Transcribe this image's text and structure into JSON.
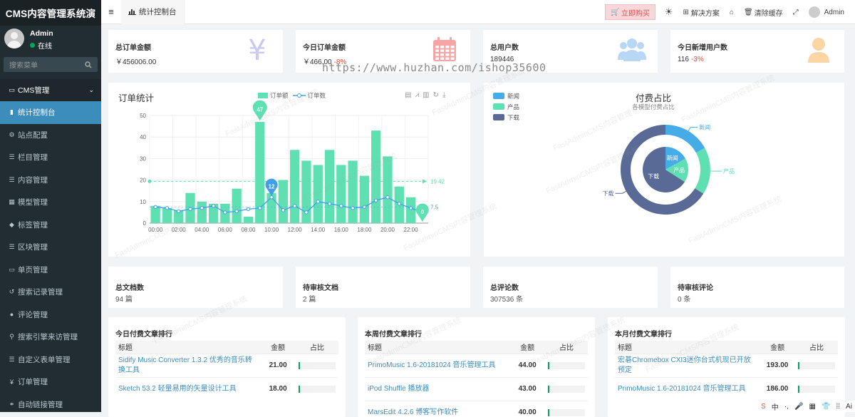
{
  "app_title": "CMS内容管理系统演",
  "user": {
    "name": "Admin",
    "status": "在线"
  },
  "search": {
    "placeholder": "搜索菜单"
  },
  "menu": {
    "header": "CMS管理",
    "items": [
      {
        "label": "统计控制台",
        "icon": "bar-chart-icon"
      },
      {
        "label": "站点配置",
        "icon": "cogs-icon"
      },
      {
        "label": "栏目管理",
        "icon": "list-icon"
      },
      {
        "label": "内容管理",
        "icon": "list-icon"
      },
      {
        "label": "模型管理",
        "icon": "grid-icon"
      },
      {
        "label": "标签管理",
        "icon": "tags-icon"
      },
      {
        "label": "区块管理",
        "icon": "list-icon"
      },
      {
        "label": "单页管理",
        "icon": "file-icon"
      },
      {
        "label": "搜索记录管理",
        "icon": "history-icon"
      },
      {
        "label": "评论管理",
        "icon": "comment-icon"
      },
      {
        "label": "搜索引擎来访管理",
        "icon": "search-icon"
      },
      {
        "label": "自定义表单管理",
        "icon": "list-icon"
      },
      {
        "label": "订单管理",
        "icon": "yen-icon"
      },
      {
        "label": "自动链接管理",
        "icon": "link-icon"
      }
    ]
  },
  "topbar": {
    "tab": "统计控制台",
    "buy": "立即购买",
    "solution": "解决方案",
    "clear_cache": "清除缓存",
    "user": "Admin"
  },
  "stats": [
    {
      "label": "总订单金额",
      "value": "￥456006.00",
      "delta": "",
      "icon": "yen-icon",
      "color": "#c9c9f2"
    },
    {
      "label": "今日订单金额",
      "value": "￥466.00",
      "delta": "-8%",
      "icon": "calendar-icon",
      "color": "#f5a5a5"
    },
    {
      "label": "总用户数",
      "value": "189446",
      "delta": "",
      "icon": "users-icon",
      "color": "#b8d7f5"
    },
    {
      "label": "今日新增用户数",
      "value": "116",
      "delta": "-3%",
      "icon": "user-icon",
      "color": "#fbd6a4"
    }
  ],
  "stats2": [
    {
      "label": "总文档数",
      "value": "94 篇"
    },
    {
      "label": "待审核文档",
      "value": "2 篇"
    },
    {
      "label": "总评论数",
      "value": "307536 条"
    },
    {
      "label": "待审核评论",
      "value": "0 条"
    }
  ],
  "chart_data": [
    {
      "type": "bar",
      "title": "订单统计",
      "legend": [
        "订单额",
        "订单数"
      ],
      "categories": [
        "00:00",
        "01:00",
        "02:00",
        "03:00",
        "04:00",
        "05:00",
        "06:00",
        "07:00",
        "08:00",
        "09:00",
        "10:00",
        "11:00",
        "12:00",
        "13:00",
        "14:00",
        "15:00",
        "16:00",
        "17:00",
        "18:00",
        "19:00",
        "20:00",
        "21:00",
        "22:00",
        "23:00"
      ],
      "ytick_labels": [
        "0",
        "10",
        "20",
        "30",
        "40",
        "50"
      ],
      "xtick_labels": [
        "00:00",
        "02:00",
        "04:00",
        "06:00",
        "08:00",
        "10:00",
        "12:00",
        "14:00",
        "16:00",
        "18:00",
        "20:00",
        "22:00"
      ],
      "ylim": [
        0,
        50
      ],
      "series": [
        {
          "name": "订单额",
          "type": "bar",
          "color": "#5fe0b3",
          "values": [
            8,
            7,
            6,
            14,
            10,
            9,
            9,
            16,
            3,
            47,
            14,
            20,
            34,
            29,
            27,
            34,
            27,
            29,
            22,
            43,
            31,
            17,
            12,
            0
          ]
        },
        {
          "name": "订单数",
          "type": "line",
          "color": "#409eea",
          "values": [
            7.5,
            7,
            5.5,
            6.5,
            7,
            8,
            5,
            5.5,
            6.5,
            7,
            12,
            6,
            8,
            5,
            10,
            9,
            8,
            7,
            7.5,
            10.5,
            12,
            9,
            7,
            5
          ]
        }
      ],
      "markers": {
        "max": "47",
        "min": "0",
        "bar_avg": "19.42",
        "line_avg": "7.5",
        "line_max": "12"
      }
    },
    {
      "type": "pie",
      "title": "付费占比",
      "subtitle": "各模型付费占比",
      "legend": [
        "新闻",
        "产品",
        "下载"
      ],
      "series": [
        {
          "name": "新闻",
          "value": 17,
          "color": "#45ace8"
        },
        {
          "name": "产品",
          "value": 17,
          "color": "#5fe0b3"
        },
        {
          "name": "下载",
          "value": 66,
          "color": "#5a6a96"
        }
      ]
    }
  ],
  "rank_tables": [
    {
      "title": "今日付费文章排行",
      "headers": [
        "标题",
        "金额",
        "占比"
      ],
      "rows": [
        [
          "Sidify Music Converter 1.3.2 优秀的音乐转换工具",
          "21.00"
        ],
        [
          "Sketch 53.2 轻量易用的矢量设计工具",
          "18.00"
        ]
      ]
    },
    {
      "title": "本周付费文章排行",
      "headers": [
        "标题",
        "金额",
        "占比"
      ],
      "rows": [
        [
          "PrimoMusic 1.6-20181024 音乐管理工具",
          "44.00"
        ],
        [
          "iPod Shuffle 播放器",
          "43.00"
        ],
        [
          "MarsEdit 4.2.6 博客写作软件",
          "40.00"
        ]
      ]
    },
    {
      "title": "本月付费文章排行",
      "headers": [
        "标题",
        "金额",
        "占比"
      ],
      "rows": [
        [
          "宏碁Chromebox CXI3迷你台式机现已开放预定",
          "193.00"
        ],
        [
          "PrimoMusic 1.6-20181024 音乐管理工具",
          "186.00"
        ]
      ]
    }
  ],
  "watermark": "FastAdminCMS内容管理系统",
  "huzhan": "https://www.huzhan.com/ishop35600",
  "tray": [
    "S",
    "中",
    "·,",
    "🎤",
    "▦",
    "👕",
    "⁞⁞",
    "Ai"
  ]
}
